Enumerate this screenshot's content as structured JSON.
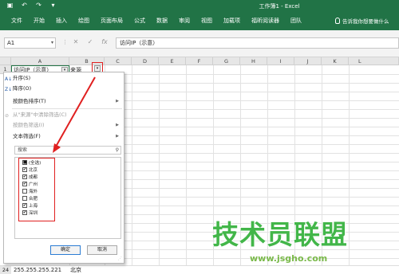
{
  "titlebar": {
    "title": "工作簿1 - Excel"
  },
  "ribbon": {
    "tabs": [
      "文件",
      "开始",
      "插入",
      "绘图",
      "页面布局",
      "公式",
      "数据",
      "审阅",
      "视图",
      "加载项",
      "福昕阅读器",
      "团队"
    ],
    "tell_me": "告诉我你想要做什么"
  },
  "formula_bar": {
    "name_box": "A1",
    "fx": "fx",
    "content": "访问IP（示意）"
  },
  "columns": [
    "A",
    "B",
    "C",
    "D",
    "E",
    "F",
    "G",
    "H",
    "I",
    "J",
    "K",
    "L"
  ],
  "cells": {
    "a1": "访问IP（示意）",
    "b1": "来源",
    "row24_num": "24",
    "a24": "255.255.255.221",
    "b24": "北京"
  },
  "row1_label": "1",
  "filter_menu": {
    "sort_asc": "升序(S)",
    "sort_desc": "降序(O)",
    "sort_by_color": "按颜色排序(T)",
    "clear_filter": "从\"来源\"中清除筛选(C)",
    "filter_by_color": "按颜色筛选(I)",
    "text_filters": "文本筛选(F)",
    "search_placeholder": "搜索",
    "items": [
      {
        "label": "(全选)",
        "state": "partial"
      },
      {
        "label": "北京",
        "state": "checked"
      },
      {
        "label": "成都",
        "state": "checked"
      },
      {
        "label": "广州",
        "state": "checked"
      },
      {
        "label": "海外",
        "state": "unchecked"
      },
      {
        "label": "合肥",
        "state": "unchecked"
      },
      {
        "label": "上海",
        "state": "checked"
      },
      {
        "label": "深圳",
        "state": "checked"
      }
    ],
    "ok": "确定",
    "cancel": "取消"
  },
  "watermark": {
    "text": "技术员联盟",
    "url": "www.jsgho.com"
  },
  "colors": {
    "excel_green": "#217346",
    "highlight_red": "#e02020",
    "watermark_green": "#42b649"
  }
}
